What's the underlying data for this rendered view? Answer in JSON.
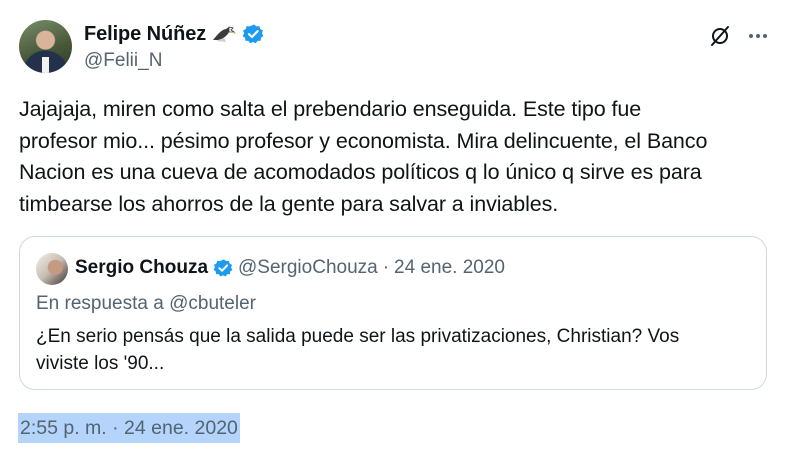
{
  "author": {
    "display_name": "Felipe Núñez",
    "handle": "@Felii_N",
    "emoji_icon": "eagle-icon",
    "verified_icon": "verified-badge-icon"
  },
  "header_actions": {
    "grok_icon": "grok-icon",
    "more_icon": "more-horizontal-icon"
  },
  "tweet": {
    "text": "Jajajaja, miren como salta el prebendario enseguida. Este tipo fue\nprofesor mio... pésimo profesor y economista. Mira delincuente, el Banco\nNacion es una cueva de acomodados políticos q lo único q sirve es para\ntimbearse los ahorros de la gente para salvar a inviables.",
    "timestamp": "2:55 p. m. · 24 ene. 2020"
  },
  "quoted_tweet": {
    "display_name": "Sergio Chouza",
    "handle": "@SergioChouza",
    "separator": "·",
    "date": "24 ene. 2020",
    "reply_context": "En respuesta a @cbuteler",
    "text": "¿En serio pensás que la salida puede ser las privatizaciones, Christian? Vos\nviviste los '90..."
  },
  "colors": {
    "text": "#0f1419",
    "secondary": "#536471",
    "verified": "#1d9bf0",
    "border": "#cfd9de",
    "selection": "#b4d4fb"
  }
}
